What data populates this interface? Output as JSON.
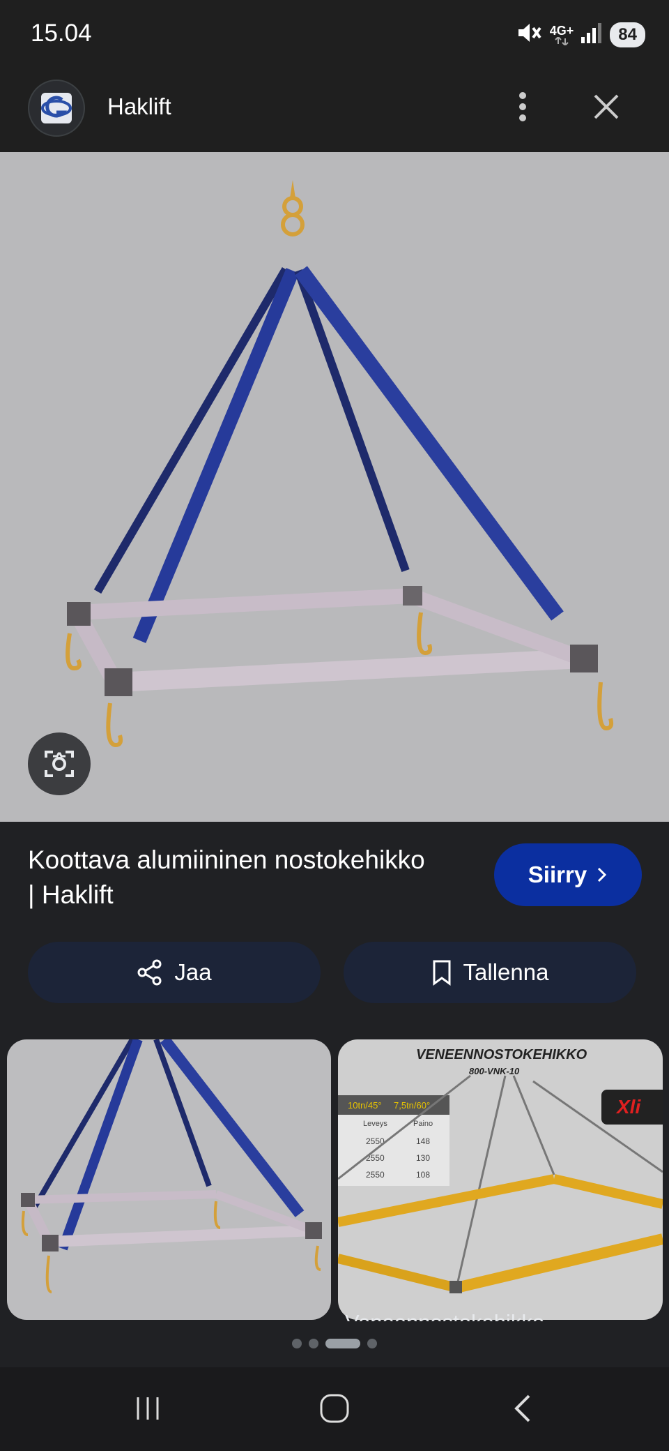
{
  "status_bar": {
    "time": "15.04",
    "network": "4G+",
    "battery": "84"
  },
  "header": {
    "site_name": "Haklift"
  },
  "result": {
    "title_line1": "Koottava alumiininen nostokehikko",
    "title_line2": "| Haklift",
    "visit_label": "Siirry"
  },
  "actions": {
    "share_label": "Jaa",
    "save_label": "Tallenna"
  },
  "related": [
    {
      "caption": ""
    },
    {
      "image_title": "VENEENNOSTOKEHIKKO",
      "image_code": "800-VNK-10",
      "table_headers": [
        "10tn/45°",
        "7,5tn/60°"
      ],
      "table_sub": [
        "Leveys",
        "Paino"
      ],
      "table_rows": [
        [
          "2550",
          "148"
        ],
        [
          "2550",
          "130"
        ],
        [
          "2550",
          "108"
        ]
      ],
      "brand": "Xli",
      "caption": "Veneennostokehikko –"
    }
  ],
  "pager": {
    "count": 4,
    "active_index": 2
  },
  "icons": {
    "mute": "mute-icon",
    "signal": "signal-icon",
    "menu": "more-vert-icon",
    "close": "close-icon",
    "lens": "lens-icon",
    "share": "share-icon",
    "bookmark": "bookmark-icon",
    "chevron": "chevron-right-icon",
    "recent": "recent-apps-icon",
    "home": "home-icon",
    "back": "back-icon"
  },
  "colors": {
    "accent": "#0b2fa0",
    "action_bg": "#1c2438",
    "background": "#202124"
  }
}
